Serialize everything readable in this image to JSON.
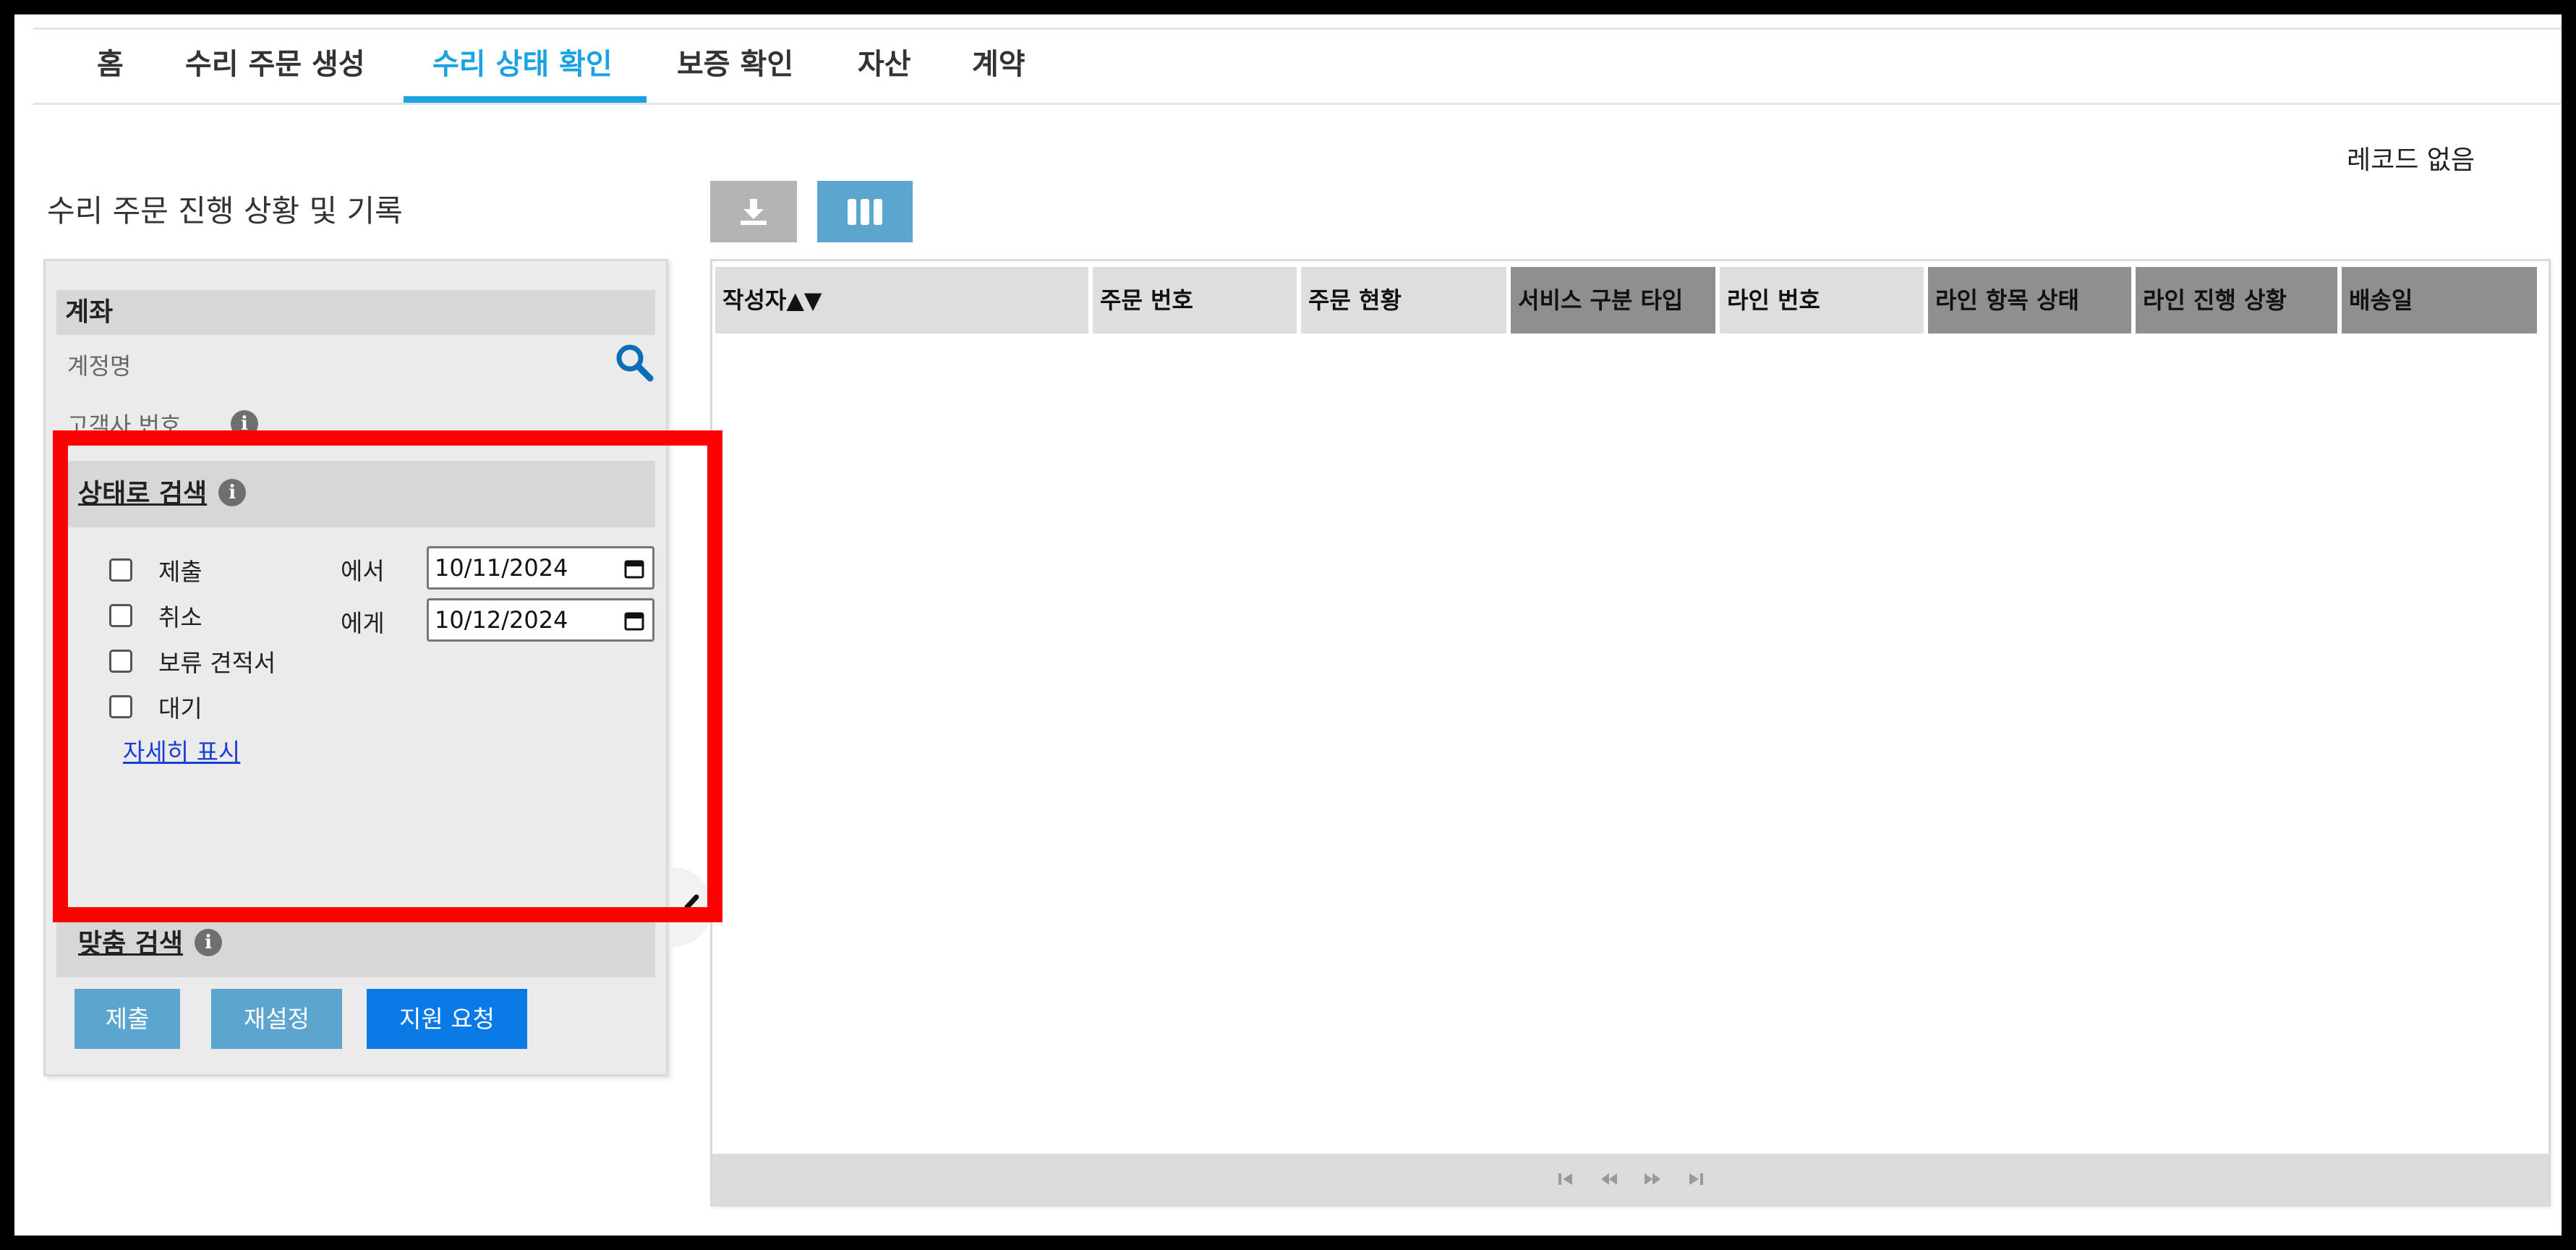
{
  "nav": {
    "tabs": [
      {
        "label": "홈"
      },
      {
        "label": "수리 주문 생성"
      },
      {
        "label": "수리 상태 확인"
      },
      {
        "label": "보증 확인"
      },
      {
        "label": "자산"
      },
      {
        "label": "계약"
      }
    ],
    "active_index": 2
  },
  "records_status": "레코드 없음",
  "page_title": "수리 주문 진행 상황 및 기록",
  "toolbar": {
    "download_icon": "download-icon",
    "columns_icon": "columns-icon"
  },
  "account": {
    "header": "계좌",
    "account_name_label": "계정명",
    "customer_number_label": "고객사 번호"
  },
  "status_search": {
    "header": "상태로 검색",
    "options": [
      {
        "label": "제출",
        "checked": false
      },
      {
        "label": "취소",
        "checked": false
      },
      {
        "label": "보류 견적서",
        "checked": false
      },
      {
        "label": "대기",
        "checked": false
      }
    ],
    "from_label": "에서",
    "from_date": "10/11/2024",
    "to_label": "에게",
    "to_date": "10/12/2024",
    "show_details": "자세히 표시"
  },
  "custom_search": {
    "header": "맞춤 검색"
  },
  "buttons": {
    "submit": "제출",
    "reset": "재설정",
    "support": "지원 요청"
  },
  "grid": {
    "columns": [
      {
        "label": "작성자▲▼",
        "style": "light"
      },
      {
        "label": "주문 번호",
        "style": "light"
      },
      {
        "label": "주문 현황",
        "style": "light"
      },
      {
        "label": "서비스 구분 타입",
        "style": "dark"
      },
      {
        "label": "라인 번호",
        "style": "light"
      },
      {
        "label": "라인 항목 상태",
        "style": "dark"
      },
      {
        "label": "라인 진행 상황",
        "style": "dark"
      },
      {
        "label": "배송일",
        "style": "dark"
      }
    ],
    "rows": []
  },
  "colors": {
    "accent": "#1aa3e0",
    "button": "#5ba5ce",
    "primary_button": "#0a7be6",
    "highlight": "#ff0000"
  }
}
